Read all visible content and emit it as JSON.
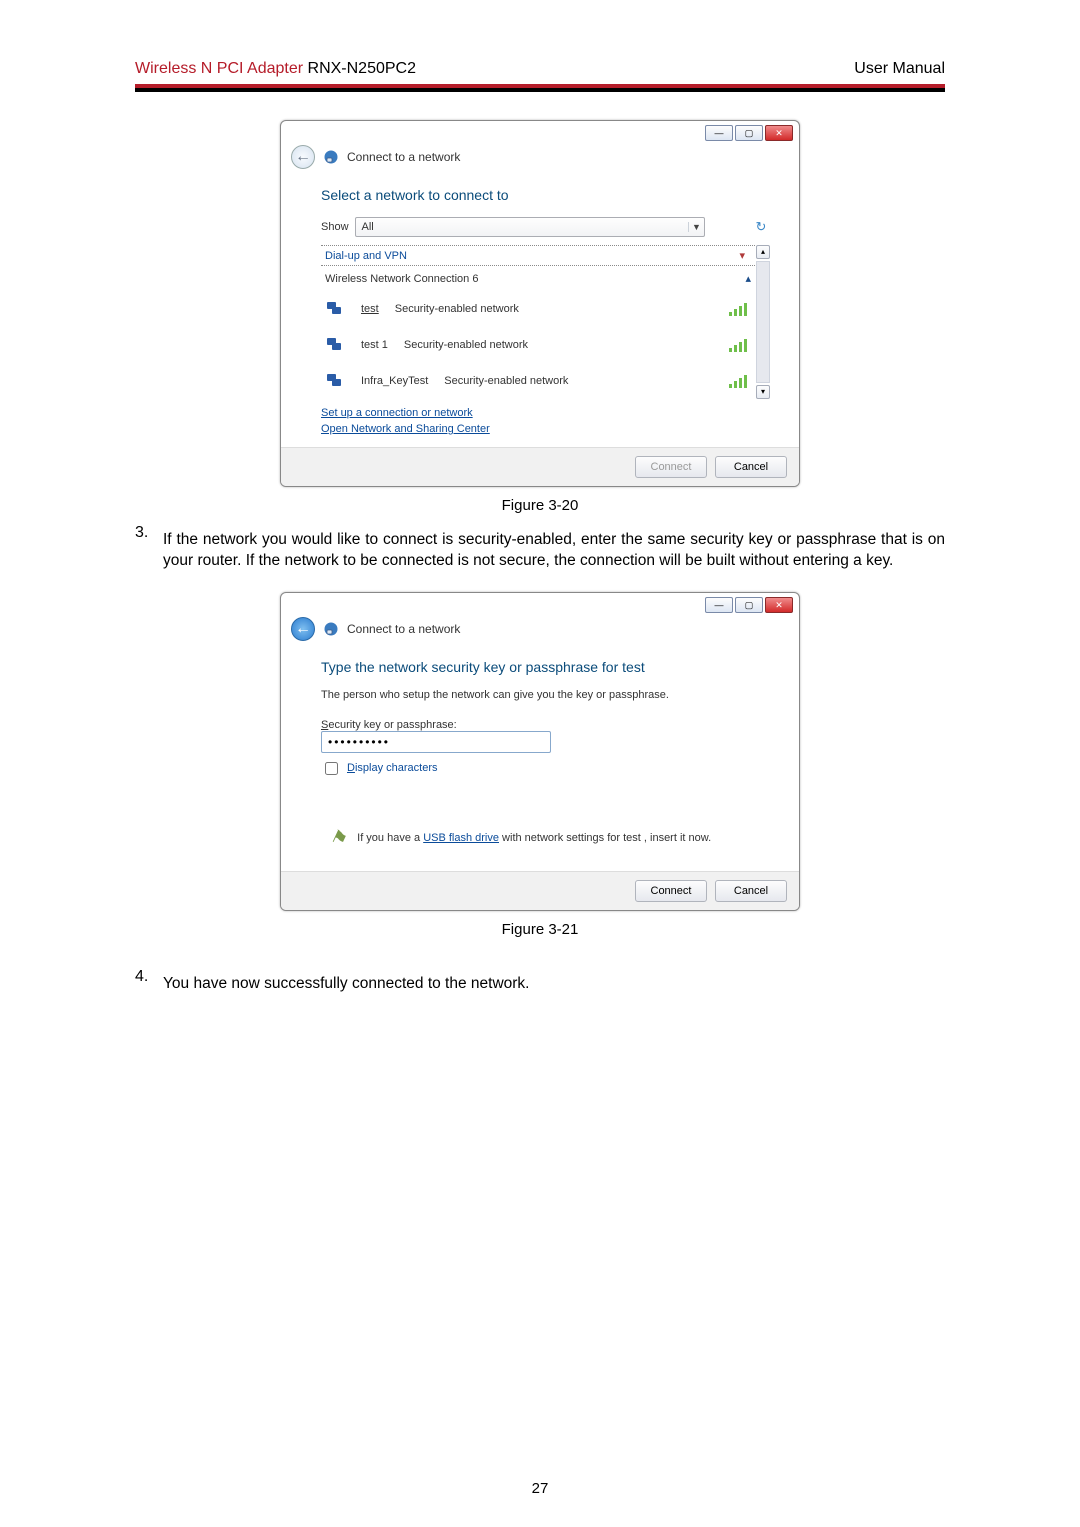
{
  "header": {
    "title_red": "Wireless N PCI Adapter",
    "title_black": " RNX-N250PC2",
    "right": "User Manual"
  },
  "dialog1": {
    "win_title": "Connect to a network",
    "heading": "Select a network to connect to",
    "show_label": "Show",
    "show_value": "All",
    "group_dialup": "Dial-up and VPN",
    "group_wireless": "Wireless Network Connection 6",
    "rows": [
      {
        "name": "test",
        "desc": "Security-enabled network"
      },
      {
        "name": "test 1",
        "desc": "Security-enabled network"
      },
      {
        "name": "Infra_KeyTest",
        "desc": "Security-enabled network"
      }
    ],
    "link1": "Set up a connection or network",
    "link2": "Open Network and Sharing Center",
    "btn_connect": "Connect",
    "btn_cancel": "Cancel"
  },
  "fig1": "Figure 3-20",
  "step3_num": "3.",
  "step3_text": "If the network you would like to connect is security-enabled, enter the same security key or passphrase that is on your router. If the network to be connected is not secure, the connection will be built without entering a key.",
  "dialog2": {
    "win_title": "Connect to a network",
    "heading": "Type the network security key or passphrase for test",
    "subtext": "The person who setup the network can give you the key or passphrase.",
    "label_pref": "S",
    "label_rest": "ecurity key or passphrase:",
    "input_value": "••••••••••",
    "chk_pref": "D",
    "chk_rest": "isplay characters",
    "usb_pre": "If you have a ",
    "usb_link": "USB flash drive",
    "usb_post": " with network settings for test , insert it now.",
    "btn_connect": "Connect",
    "btn_cancel": "Cancel"
  },
  "fig2": "Figure 3-21",
  "step4_num": "4.",
  "step4_text": "You have now successfully connected to the network.",
  "page_number": "27"
}
